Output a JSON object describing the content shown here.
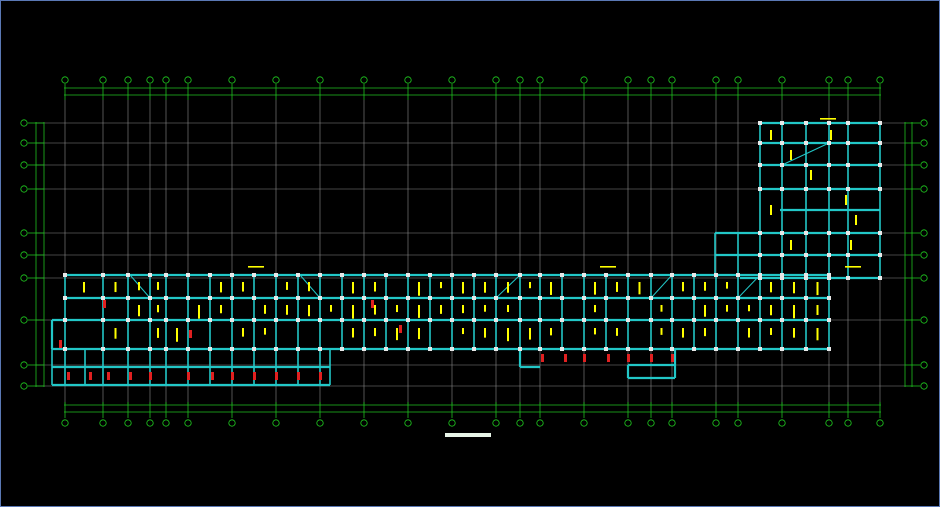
{
  "drawing": {
    "colors": {
      "background": "#000000",
      "axis_line": "#20c020",
      "axis_bubble": "#20d020",
      "grid": "#8a8a8a",
      "beam": "#22c7c7",
      "label": "#ffff00",
      "column_fill": "#e8e8e8",
      "rebar_mark": "#e02020",
      "frame": "#5a78b4"
    },
    "title_underline": "visible",
    "notes_present": true
  }
}
